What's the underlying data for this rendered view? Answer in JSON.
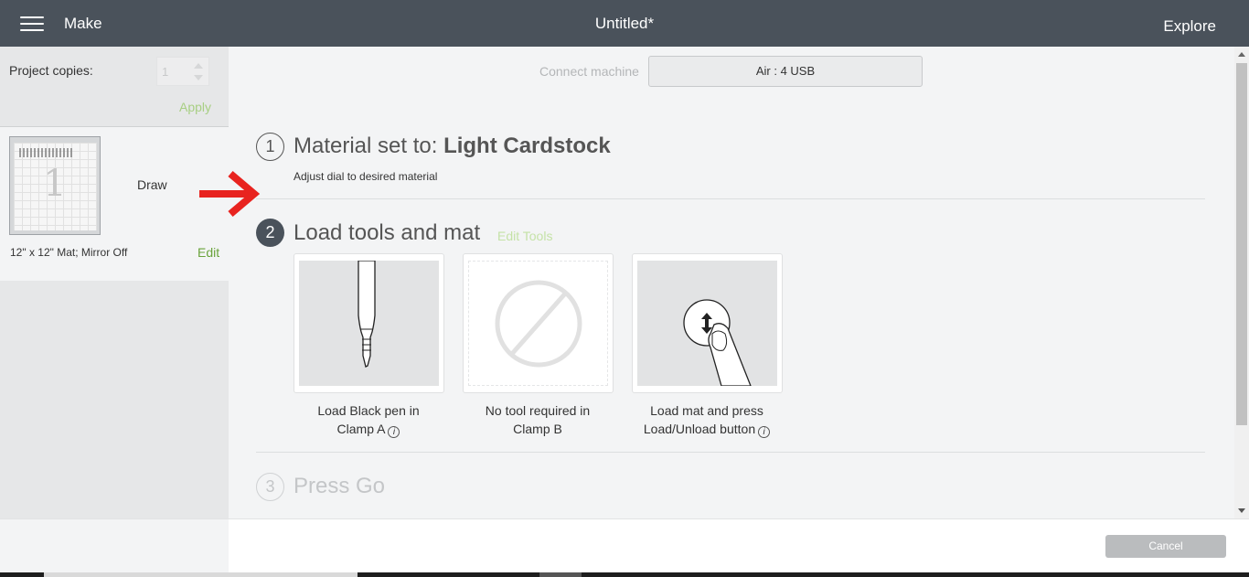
{
  "header": {
    "menu_icon": "hamburger-menu-icon",
    "app_label": "Make",
    "document_title": "Untitled*",
    "explore_label": "Explore"
  },
  "sidebar": {
    "copies_label": "Project copies:",
    "copies_value": "1",
    "apply_label": "Apply",
    "mat": {
      "mode_label": "Draw",
      "caption": "12\" x 12\" Mat; Mirror Off",
      "edit_label": "Edit",
      "thumbnail_number": "1"
    }
  },
  "connection": {
    "label": "Connect machine",
    "machine": "Air : 4 USB"
  },
  "steps": [
    {
      "number": "1",
      "title_prefix": "Material set to: ",
      "title_material": "Light Cardstock",
      "subtitle": "Adjust dial to desired material"
    },
    {
      "number": "2",
      "title": "Load tools and mat",
      "edit_tools_label": "Edit Tools",
      "cards": [
        {
          "line1": "Load Black pen in",
          "line2": "Clamp A",
          "icon": "pen-tool-icon",
          "has_info": true
        },
        {
          "line1": "No tool required in",
          "line2": "Clamp B",
          "icon": "no-tool-icon",
          "has_info": false
        },
        {
          "line1": "Load mat and press",
          "line2": "Load/Unload button",
          "icon": "press-load-button-icon",
          "has_info": true
        }
      ]
    },
    {
      "number": "3",
      "title": "Press Go"
    }
  ],
  "footer": {
    "cancel_label": "Cancel"
  },
  "colors": {
    "header_bg": "#4a525b",
    "accent_green": "#6aa33c",
    "annotation_arrow": "#e8231f"
  }
}
